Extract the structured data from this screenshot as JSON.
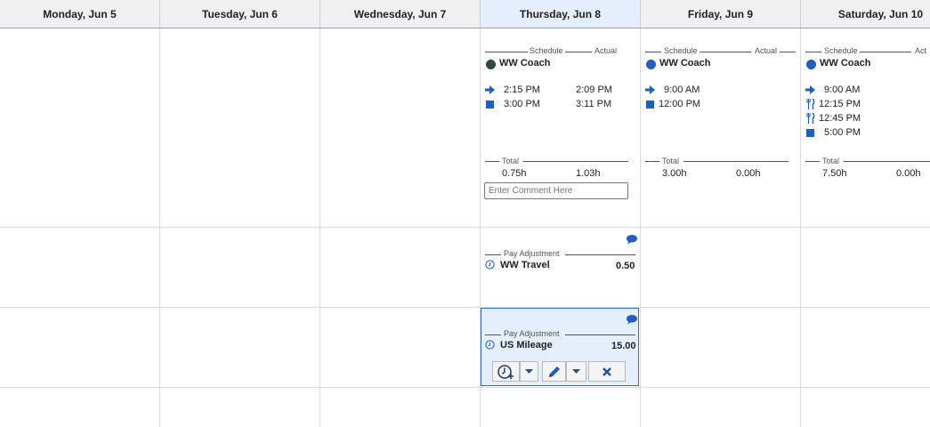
{
  "days": [
    {
      "label": "Monday, Jun 5"
    },
    {
      "label": "Tuesday, Jun 6"
    },
    {
      "label": "Wednesday, Jun 7"
    },
    {
      "label": "Thursday, Jun 8"
    },
    {
      "label": "Friday, Jun 9"
    },
    {
      "label": "Saturday, Jun 10"
    }
  ],
  "labels": {
    "schedule": "Schedule",
    "actual": "Actual",
    "actual_cut": "Act",
    "total": "Total",
    "pay_adjustment": "Pay Adjustment"
  },
  "thursday": {
    "name": "WW Coach",
    "dot_color": "#2f4a35",
    "rows": [
      {
        "icon": "arrow-right-icon",
        "schedule": "2:15 PM",
        "actual": "2:09 PM"
      },
      {
        "icon": "stop-square-icon",
        "schedule": "3:00 PM",
        "actual": "3:11 PM"
      }
    ],
    "total_schedule": "0.75h",
    "total_actual": "1.03h",
    "comment_placeholder": "Enter Comment Here",
    "adjustments": [
      {
        "name": "WW Travel",
        "amount": "0.50"
      },
      {
        "name": "US Mileage",
        "amount": "15.00"
      }
    ]
  },
  "friday": {
    "name": "WW Coach",
    "dot_color": "#1f5fbf",
    "rows": [
      {
        "icon": "arrow-right-icon",
        "time": "9:00 AM"
      },
      {
        "icon": "stop-square-icon",
        "time": "12:00 PM"
      }
    ],
    "total_schedule": "3.00h",
    "total_actual": "0.00h"
  },
  "saturday": {
    "name": "WW Coach",
    "dot_color": "#1f5fbf",
    "rows": [
      {
        "icon": "arrow-right-icon",
        "time": "9:00 AM"
      },
      {
        "icon": "meal-icon",
        "time": "12:15 PM"
      },
      {
        "icon": "meal-icon",
        "time": "12:45 PM"
      },
      {
        "icon": "stop-square-icon",
        "time": "5:00 PM"
      }
    ],
    "total_schedule": "7.50h",
    "total_actual": "0.00h"
  },
  "colors": {
    "accent": "#1f5fbf",
    "selected_bg": "#e4eefc",
    "header_today": "#e4eefc"
  }
}
